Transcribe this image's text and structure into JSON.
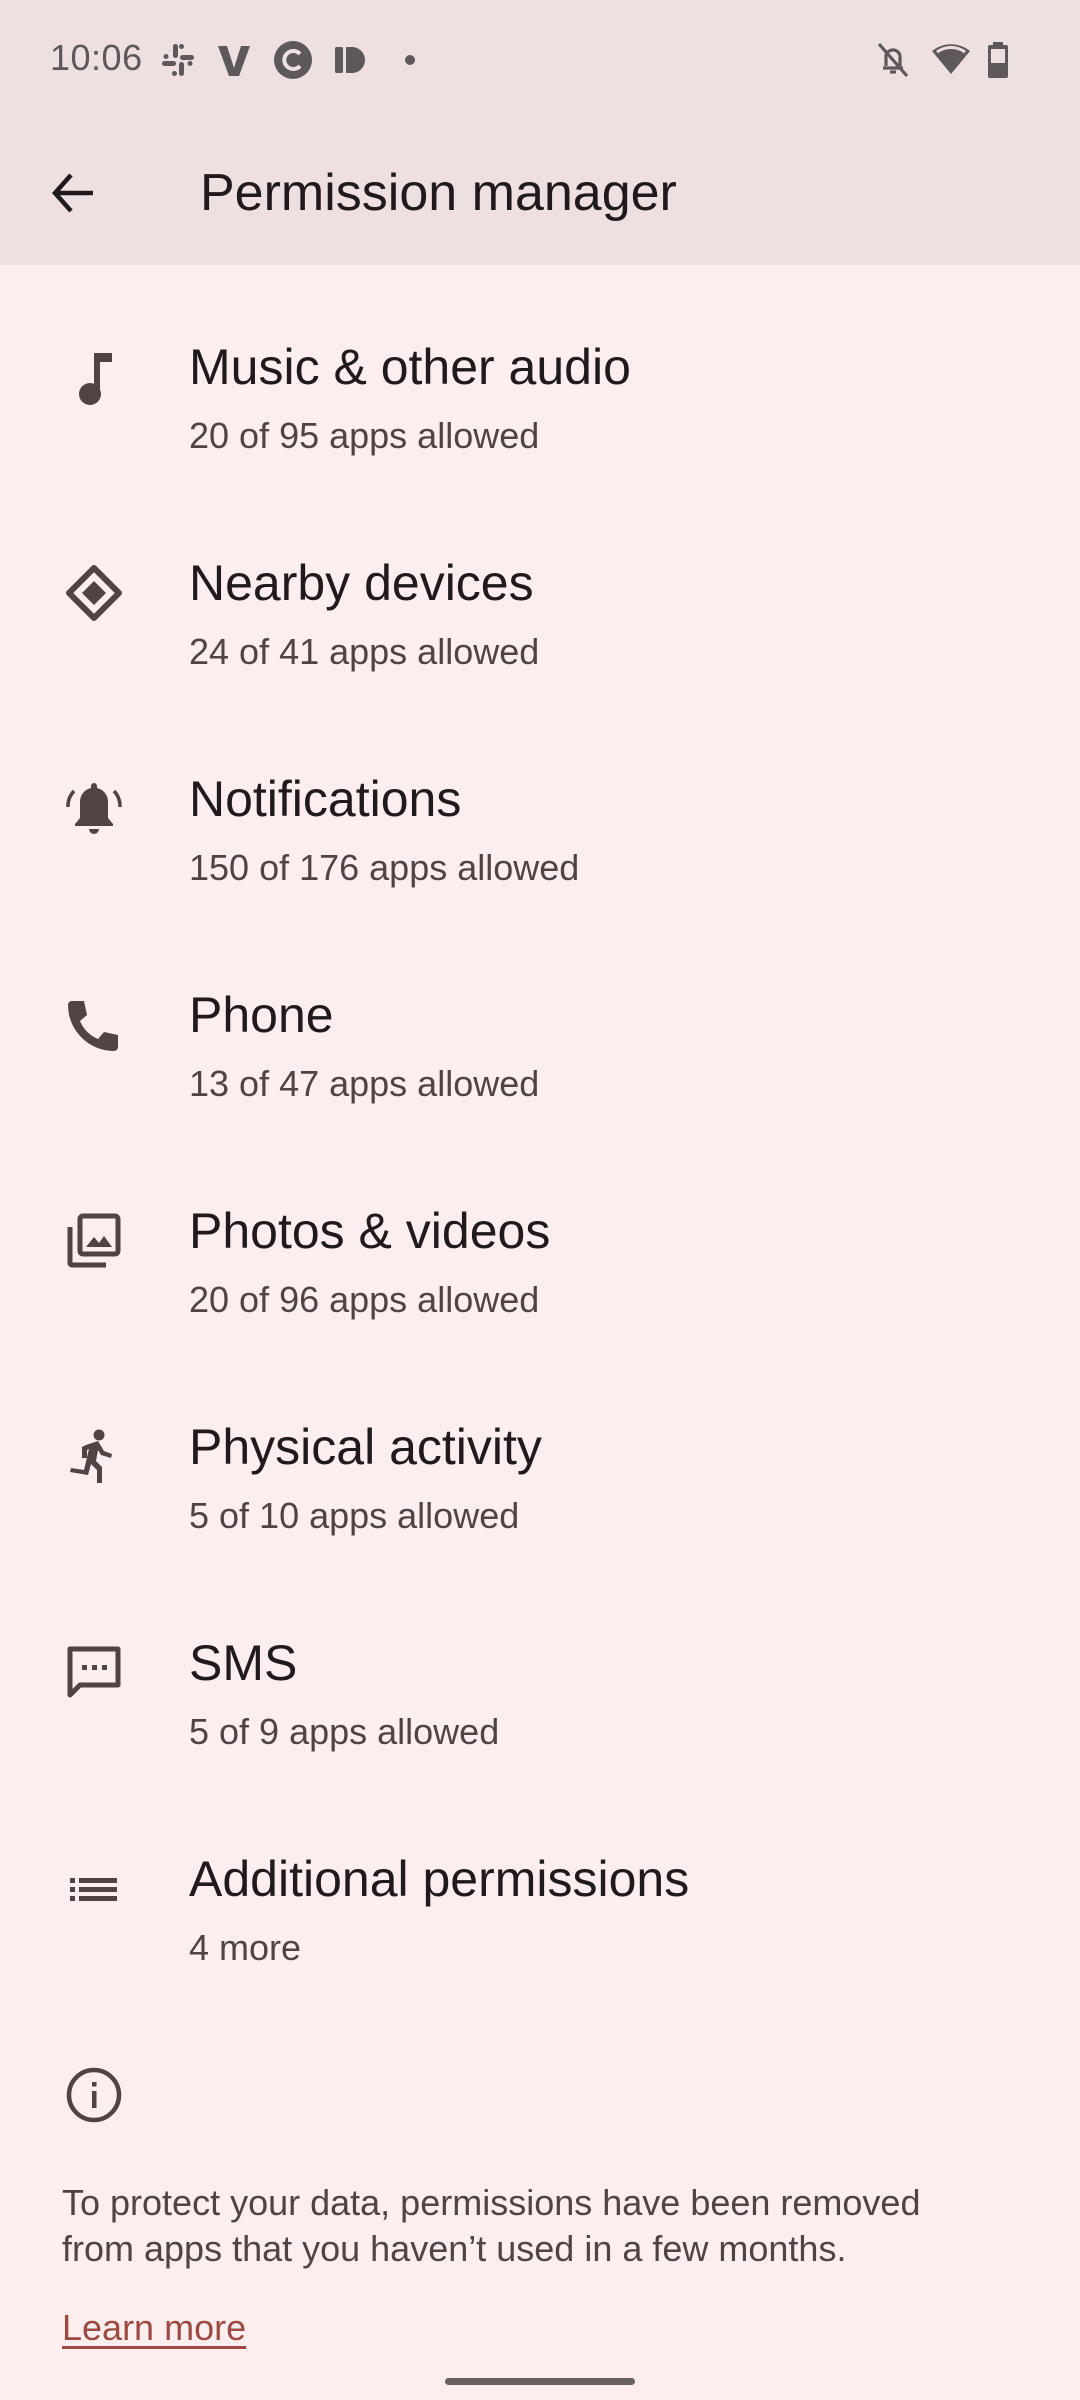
{
  "status_bar": {
    "time": "10:06",
    "notification_icons": [
      "slack-icon",
      "venmo-icon",
      "c-app-icon",
      "pocket-casts-icon",
      "more-dot-icon"
    ],
    "system_icons": [
      "notifications-off-icon",
      "wifi-icon",
      "battery-icon"
    ]
  },
  "app_bar": {
    "back_icon": "arrow-back-icon",
    "title": "Permission manager"
  },
  "permissions": [
    {
      "icon": "music-note-icon",
      "title": "Music & other audio",
      "subtitle": "20 of 95 apps allowed"
    },
    {
      "icon": "nearby-devices-icon",
      "title": "Nearby devices",
      "subtitle": "24 of 41 apps allowed"
    },
    {
      "icon": "notifications-bell-icon",
      "title": "Notifications",
      "subtitle": "150 of 176 apps allowed"
    },
    {
      "icon": "phone-icon",
      "title": "Phone",
      "subtitle": "13 of 47 apps allowed"
    },
    {
      "icon": "photo-library-icon",
      "title": "Photos & videos",
      "subtitle": "20 of 96 apps allowed"
    },
    {
      "icon": "directions-run-icon",
      "title": "Physical activity",
      "subtitle": "5 of 10 apps allowed"
    },
    {
      "icon": "sms-icon",
      "title": "SMS",
      "subtitle": "5 of 9 apps allowed"
    },
    {
      "icon": "list-icon",
      "title": "Additional permissions",
      "subtitle": "4 more"
    }
  ],
  "footer": {
    "info_icon": "info-icon",
    "message": "To protect your data, permissions have been removed from apps that you haven’t used in a few months.",
    "learn_more": "Learn more"
  },
  "colors": {
    "app_bar_bg": "#EDE0E0",
    "surface_bg": "#FCEEEE",
    "icon": "#524343",
    "link": "#9C4A42"
  }
}
